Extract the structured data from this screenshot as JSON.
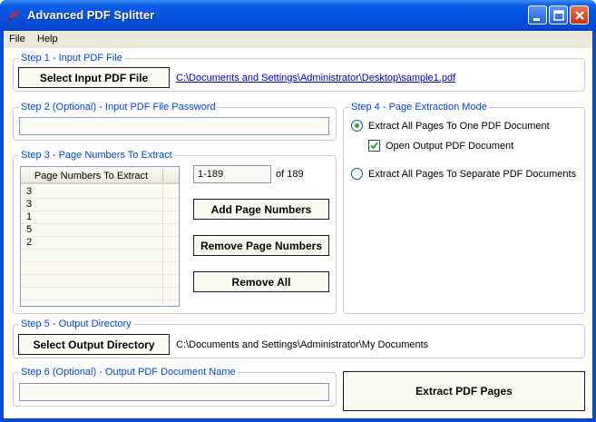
{
  "window": {
    "title": "Advanced PDF Splitter"
  },
  "menu": {
    "file": "File",
    "help": "Help"
  },
  "step1": {
    "label": "Step 1 - Input PDF File",
    "button": "Select Input PDF File",
    "path": "C:\\Documents and Settings\\Administrator\\Desktop\\sample1.pdf"
  },
  "step2": {
    "label": "Step 2 (Optional) - Input PDF File Password",
    "value": ""
  },
  "step3": {
    "label": "Step 3 - Page Numbers To Extract",
    "column_header": "Page Numbers To Extract",
    "rows": [
      "3",
      "3",
      "1",
      "5",
      "2"
    ],
    "range_value": "1-189",
    "of_total": "of 189",
    "add_button": "Add Page Numbers",
    "remove_button": "Remove Page Numbers",
    "remove_all_button": "Remove All"
  },
  "step4": {
    "label": "Step 4 - Page Extraction Mode",
    "option_one": "Extract All Pages To One PDF Document",
    "option_one_checked": true,
    "open_output": "Open Output PDF Document",
    "open_output_checked": true,
    "option_separate": "Extract All Pages To Separate PDF Documents",
    "option_separate_checked": false
  },
  "step5": {
    "label": "Step 5 - Output Directory",
    "button": "Select Output Directory",
    "path": "C:\\Documents and Settings\\Administrator\\My Documents"
  },
  "step6": {
    "label": "Step 6 (Optional) - Output PDF Document Name",
    "value": ""
  },
  "extract_button": "Extract PDF Pages",
  "colors": {
    "title_bar": "#0554df",
    "group_label": "#0046d5",
    "link": "#0000cc",
    "radio_selected": "#2aa72a"
  },
  "icons": {
    "app": "pdf-split-icon",
    "minimize": "minimize-icon",
    "maximize": "maximize-icon",
    "close": "close-icon",
    "check": "checkmark-icon"
  }
}
